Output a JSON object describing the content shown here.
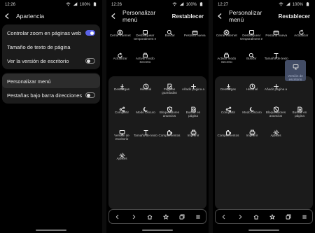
{
  "screen1": {
    "status": {
      "time": "12:26",
      "battery": "100%"
    },
    "title": "Apariencia",
    "group1": [
      {
        "label": "Controlar zoom en páginas web",
        "toggle": "on"
      },
      {
        "label": "Tamaño de texto de página",
        "toggle": "none"
      },
      {
        "label": "Ver la versión de escritorio",
        "toggle": "off"
      }
    ],
    "group2": [
      {
        "label": "Personalizar menú",
        "toggle": "none"
      },
      {
        "label": "Pestañas bajo barra direcciones",
        "toggle": "off"
      }
    ]
  },
  "screen2": {
    "status": {
      "time": "12:26",
      "battery": "100%"
    },
    "title": "Personalizar menú",
    "action": "Restablecer",
    "top_items": [
      {
        "label": "Cerrar Internet",
        "icon": "close-circle-icon"
      },
      {
        "label": "Desbloquear temporalment e",
        "icon": "unlock-icon"
      },
      {
        "label": "Buscar",
        "icon": "search-icon"
      },
      {
        "label": "Pestaña nueva",
        "icon": "new-tab-icon"
      },
      {
        "label": "Actualizar",
        "icon": "refresh-icon"
      },
      {
        "label": "Activar modo Secreto",
        "icon": "secret-mode-icon"
      }
    ],
    "lower_items": [
      {
        "label": "Descargas",
        "icon": "download-icon"
      },
      {
        "label": "Historial",
        "icon": "history-icon"
      },
      {
        "label": "Páginas guardadas",
        "icon": "saved-pages-icon"
      },
      {
        "label": "Añadir página a",
        "icon": "plus-icon"
      },
      {
        "label": "Compartir",
        "icon": "share-icon"
      },
      {
        "label": "Modo Oscuro",
        "icon": "moon-icon"
      },
      {
        "label": "Bloqueadores anuncios",
        "icon": "shield-block-icon"
      },
      {
        "label": "Buscar en página",
        "icon": "find-in-page-icon"
      },
      {
        "label": "Versión de escritorio",
        "icon": "desktop-icon"
      },
      {
        "label": "Tamaño de texto",
        "icon": "text-size-icon"
      },
      {
        "label": "Complementos",
        "icon": "addons-icon"
      },
      {
        "label": "Imprimir",
        "icon": "print-icon"
      },
      {
        "label": "Ajustes",
        "icon": "gear-icon"
      }
    ]
  },
  "screen3": {
    "status": {
      "time": "12:27",
      "battery": "100%"
    },
    "title": "Personalizar menú",
    "action": "Restablecer",
    "top_items": [
      {
        "label": "Cerrar Internet",
        "icon": "close-circle-icon"
      },
      {
        "label": "Desbloquear temporalment e",
        "icon": "unlock-icon"
      },
      {
        "label": "Pestaña nueva",
        "icon": "new-tab-icon"
      },
      {
        "label": "Actualizar",
        "icon": "refresh-icon"
      },
      {
        "label": "Activar modo Secreto",
        "icon": "secret-mode-icon"
      },
      {
        "label": "Buscar",
        "icon": "search-icon"
      },
      {
        "label": "Tamaño de texto",
        "icon": "text-size-icon"
      }
    ],
    "dragging": {
      "label": "Versión de escritorio",
      "icon": "desktop-icon"
    },
    "lower_items": [
      {
        "label": "Descargas",
        "icon": "download-icon"
      },
      {
        "label": "Historial",
        "icon": "history-icon"
      },
      {
        "label": "Añadir página a",
        "icon": "plus-icon"
      },
      {
        "label": "",
        "icon": "none"
      },
      {
        "label": "Compartir",
        "icon": "share-icon"
      },
      {
        "label": "Modo Oscuro",
        "icon": "moon-icon"
      },
      {
        "label": "Bloqueadores anuncios",
        "icon": "shield-block-icon"
      },
      {
        "label": "Buscar en página",
        "icon": "find-in-page-icon"
      },
      {
        "label": "Complementos",
        "icon": "addons-icon"
      },
      {
        "label": "Imprimir",
        "icon": "print-icon"
      },
      {
        "label": "Ajustes",
        "icon": "gear-icon"
      }
    ]
  },
  "navbar": [
    "back-icon",
    "forward-icon",
    "home-icon",
    "bookmark-star-icon",
    "tabs-icon",
    "menu-icon"
  ],
  "colors": {
    "accent": "#5a63e8",
    "card": "#1b1b1b",
    "background": "#000000"
  }
}
